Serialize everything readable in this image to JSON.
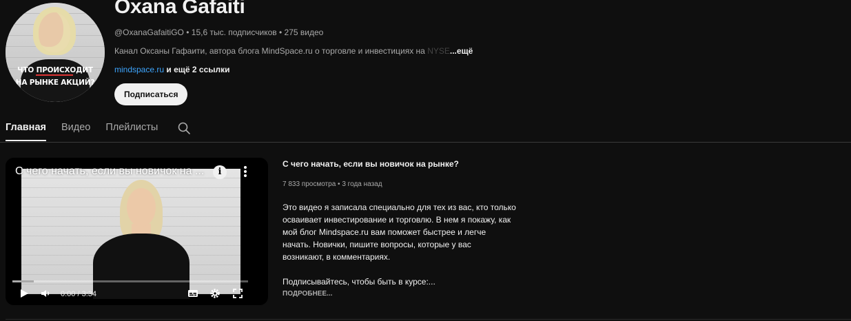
{
  "channel": {
    "name": "Oxana Gafaiti",
    "handle": "@OxanaGafaitiGO",
    "subscribers": "15,6 тыс. подписчиков",
    "videos_count": "275 видео",
    "meta_separator": "•",
    "description": "Канал Оксаны Гафаити, автора блога MindSpace.ru о торговле и инвестициях на",
    "description_faded": "NYSE",
    "description_more": "...ещё",
    "link": "mindspace.ru",
    "more_links": "и ещё 2 ссылки",
    "subscribe_label": "Подписаться",
    "avatar_caption_line1": "ЧТО ПРОИСХОДИТ",
    "avatar_caption_line2": "НА РЫНКЕ АКЦИЙ?"
  },
  "tabs": [
    {
      "label": "Главная",
      "active": true
    },
    {
      "label": "Видео",
      "active": false
    },
    {
      "label": "Плейлисты",
      "active": false
    }
  ],
  "icons": {
    "search": "search-icon",
    "info": "info-icon",
    "more": "more-vert-icon",
    "play": "play-icon",
    "volume": "volume-icon",
    "subtitles": "subtitles-icon",
    "settings": "gear-icon",
    "fullscreen": "fullscreen-icon"
  },
  "colors": {
    "background": "#0f0f0f",
    "link": "#3ea6ff",
    "text": "#f1f1f1",
    "muted": "#aaaaaa"
  },
  "player": {
    "overlay_title": "С чего начать, если вы новичок на ...",
    "info_glyph": "i",
    "time": "0:00 / 3:34",
    "progress_fraction": 0.09
  },
  "featured": {
    "title": "С чего начать, если вы новичок на рынке?",
    "views": "7 833 просмотра",
    "age": "3 года назад",
    "description_lines": [
      "Это видео я записала специально для тех из вас, кто только",
      "осваивает инвестирование и торговлю. В нем я покажу, как",
      "мой блог Mindspace.ru вам поможет быстрее и легче",
      "начать. Новички, пишите вопросы, которые у вас",
      "возникают, в комментариях."
    ],
    "description_last": "Подписывайтесь, чтобы быть в курсе:...",
    "more_label": "ПОДРОБНЕЕ..."
  }
}
